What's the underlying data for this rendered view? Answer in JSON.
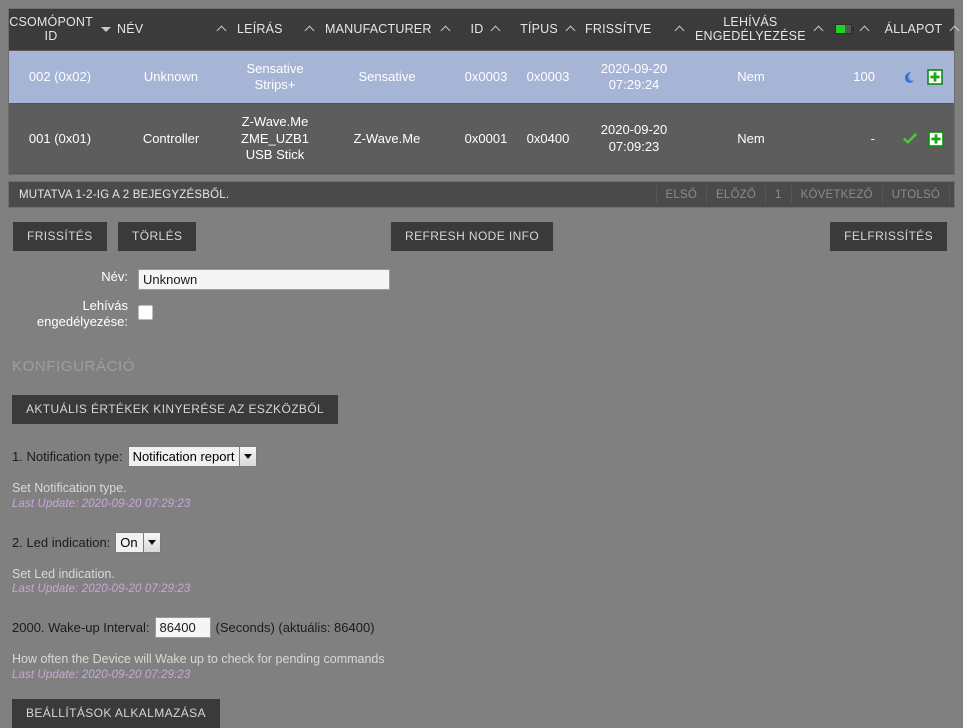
{
  "table": {
    "columns": [
      {
        "label": "CSOMÓPONT ID",
        "sort": "down-solid",
        "icon": null
      },
      {
        "label": "NÉV",
        "sort": "up",
        "icon": null
      },
      {
        "label": "LEÍRÁS",
        "sort": "up",
        "icon": null
      },
      {
        "label": "MANUFACTURER",
        "sort": "up",
        "icon": null
      },
      {
        "label": "ID",
        "sort": "up",
        "icon": null
      },
      {
        "label": "TÍPUS",
        "sort": "up",
        "icon": null
      },
      {
        "label": "FRISSÍTVE",
        "sort": "up",
        "icon": null
      },
      {
        "label": "LEHÍVÁS ENGEDÉLYEZÉSE",
        "sort": "up",
        "icon": null
      },
      {
        "label": "",
        "sort": "up",
        "icon": "battery-icon"
      },
      {
        "label": "ÁLLAPOT",
        "sort": "up",
        "icon": null
      }
    ],
    "rows": [
      {
        "selected": true,
        "node_id": "002 (0x02)",
        "name": "Unknown",
        "description": "Sensative Strips+",
        "manufacturer": "Sensative",
        "id": "0x0003",
        "type": "0x0003",
        "updated": "2020-09-20 07:29:24",
        "wakeup_enabled": "Nem",
        "battery": "100",
        "status_icons": [
          "moon-icon",
          "plus-icon"
        ]
      },
      {
        "selected": false,
        "node_id": "001 (0x01)",
        "name": "Controller",
        "description": "Z-Wave.Me ZME_UZB1 USB Stick",
        "manufacturer": "Z-Wave.Me",
        "id": "0x0001",
        "type": "0x0400",
        "updated": "2020-09-20 07:09:23",
        "wakeup_enabled": "Nem",
        "battery": "-",
        "status_icons": [
          "check-icon",
          "plus-icon"
        ]
      }
    ]
  },
  "pagination": {
    "info": "MUTATVA 1-2-IG A 2 BEJEGYZÉSBŐL.",
    "buttons": [
      "ELSŐ",
      "ELŐZŐ",
      "1",
      "KÖVETKEZŐ",
      "UTOLSÓ"
    ]
  },
  "actions": {
    "refresh": "FRISSÍTÉS",
    "delete": "TÖRLÉS",
    "refresh_node_info": "REFRESH NODE INFO",
    "reload": "FELFRISSÍTÉS"
  },
  "form": {
    "name_label": "Név:",
    "name_value": "Unknown",
    "name_placeholder": "",
    "wakeup_label": "Lehívás engedélyezése:",
    "wakeup_checked": false
  },
  "config": {
    "title": "KONFIGURÁCIÓ",
    "pull_button": "AKTUÁLIS ÉRTÉKEK KINYERÉSE AZ ESZKÖZBŐL",
    "apply_button": "BEÁLLÍTÁSOK ALKALMAZÁSA",
    "params": [
      {
        "label": "1. Notification type:",
        "control": "select",
        "value": "Notification report",
        "suffix": "",
        "description": "Set Notification type.",
        "last_update": "Last Update: 2020-09-20 07:29:23"
      },
      {
        "label": "2. Led indication:",
        "control": "select",
        "value": "On",
        "suffix": "",
        "description": "Set Led indication.",
        "last_update": "Last Update: 2020-09-20 07:29:23"
      },
      {
        "label": "2000. Wake-up Interval:",
        "control": "number",
        "value": "86400",
        "suffix": "(Seconds) (aktuális: 86400)",
        "description": "How often the Device will Wake up to check for pending commands",
        "last_update": "Last Update: 2020-09-20 07:29:23"
      }
    ]
  },
  "colors": {
    "page_bg": "#808080",
    "table_header_bg": "#3b3b3b",
    "row_selected_bg": "#a6b4d6",
    "row_bg": "#5d5d5d",
    "button_bg": "#3a3a3a",
    "accent_green": "#1fd320",
    "last_update": "#c9a6d8"
  }
}
